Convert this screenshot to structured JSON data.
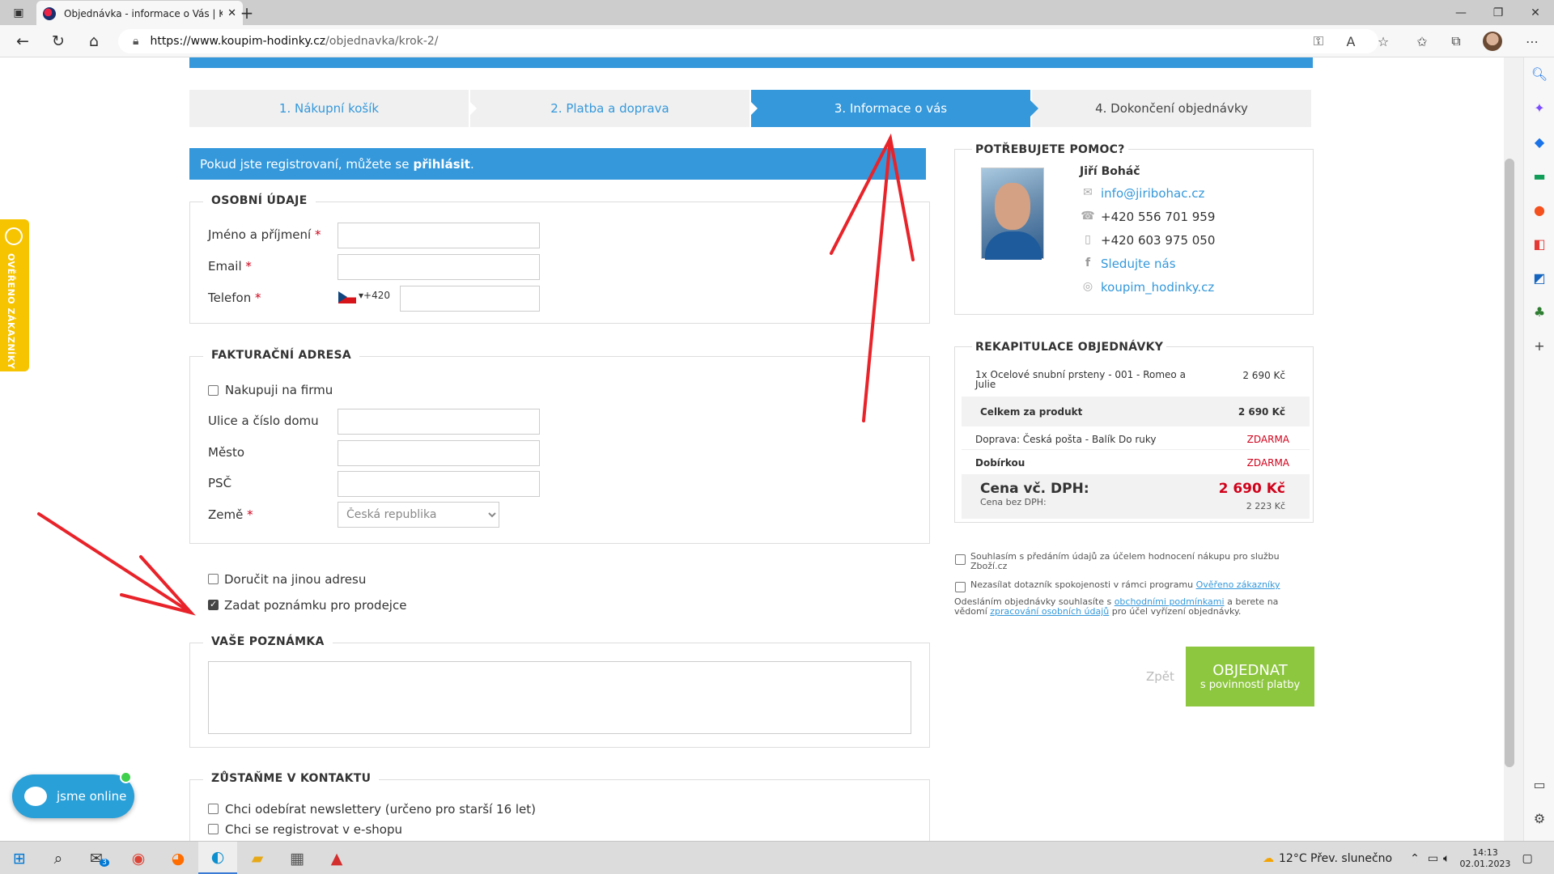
{
  "browser": {
    "tab_title": "Objednávka - informace o Vás | K",
    "url_host": "https://www.koupim-hodinky.cz",
    "url_path": "/objednavka/krok-2/"
  },
  "steps": [
    {
      "label": "1. Nákupní košík",
      "state": "done"
    },
    {
      "label": "2. Platba a doprava",
      "state": "done"
    },
    {
      "label": "3. Informace o vás",
      "state": "active"
    },
    {
      "label": "4. Dokončení objednávky",
      "state": "todo"
    }
  ],
  "login_bar": {
    "text": "Pokud jste registrovaní, můžete se",
    "link": "přihlásit",
    "end": "."
  },
  "personal": {
    "legend": "OSOBNÍ ÚDAJE",
    "name_label": "Jméno a příjmení",
    "email_label": "Email",
    "phone_label": "Telefon",
    "phone_prefix": "+420",
    "required_mark": "*"
  },
  "billing": {
    "legend": "FAKTURAČNÍ ADRESA",
    "company_checkbox": "Nakupuji na firmu",
    "street_label": "Ulice a číslo domu",
    "city_label": "Město",
    "zip_label": "PSČ",
    "country_label": "Země",
    "country_value": "Česká republika"
  },
  "options": {
    "other_address": {
      "label": "Doručit na jinou adresu",
      "checked": false
    },
    "note_for_seller": {
      "label": "Zadat poznámku pro prodejce",
      "checked": true
    }
  },
  "note": {
    "legend": "VAŠE POZNÁMKA",
    "value": ""
  },
  "contact": {
    "legend": "ZŮSTAŇME V KONTAKTU",
    "newsletter": "Chci odebírat newslettery (určeno pro starší 16 let)",
    "register": "Chci se registrovat v e-shopu"
  },
  "help": {
    "title": "POTŘEBUJETE POMOC?",
    "name": "Jiří Boháč",
    "email": "info@jiribohac.cz",
    "phone1": "+420 556 701 959",
    "phone2": "+420 603 975 050",
    "facebook": "Sledujte nás",
    "instagram": "koupim_hodinky.cz"
  },
  "recap": {
    "title": "REKAPITULACE OBJEDNÁVKY",
    "item_name": "1x Ocelové snubní prsteny - 001 - Romeo a Julie",
    "item_price": "2 690 Kč",
    "subtotal_label": "Celkem za produkt",
    "subtotal_value": "2 690 Kč",
    "shipping_label": "Doprava: Česká pošta - Balík Do ruky",
    "shipping_value": "ZDARMA",
    "payment_label": "Dobírkou",
    "payment_value": "ZDARMA",
    "total_label": "Cena vč. DPH:",
    "total_value": "2 690 Kč",
    "net_label": "Cena bez DPH:",
    "net_value": "2 223 Kč"
  },
  "consents": {
    "zbozi": "Souhlasím s předáním údajů za účelem hodnocení nákupu pro službu Zboží.cz",
    "survey_pre": "Nezasílat dotazník spokojenosti v rámci programu",
    "survey_link": "Ověřeno zákazníky",
    "terms_1": "Odesláním objednávky souhlasíte s",
    "terms_link1": "obchodními podmínkami",
    "terms_2": "a berete na vědomí",
    "terms_link2": "zpracování osobních údajů",
    "terms_3": "pro účel vyřízení objednávky."
  },
  "actions": {
    "back": "Zpět",
    "order_main": "OBJEDNAT",
    "order_sub": "s povinností platby"
  },
  "badges": {
    "verified": "OVĚŘENO ZÁKAZNÍKY",
    "chat": "jsme online"
  },
  "taskbar": {
    "weather": "12°C  Přev. slunečno",
    "time": "14:13",
    "date": "02.01.2023",
    "mail_badge": "3"
  },
  "colors": {
    "accent": "#3498db",
    "order_button": "#8dc63f",
    "required": "#d0021b",
    "annotation_arrow": "#e8232a"
  }
}
